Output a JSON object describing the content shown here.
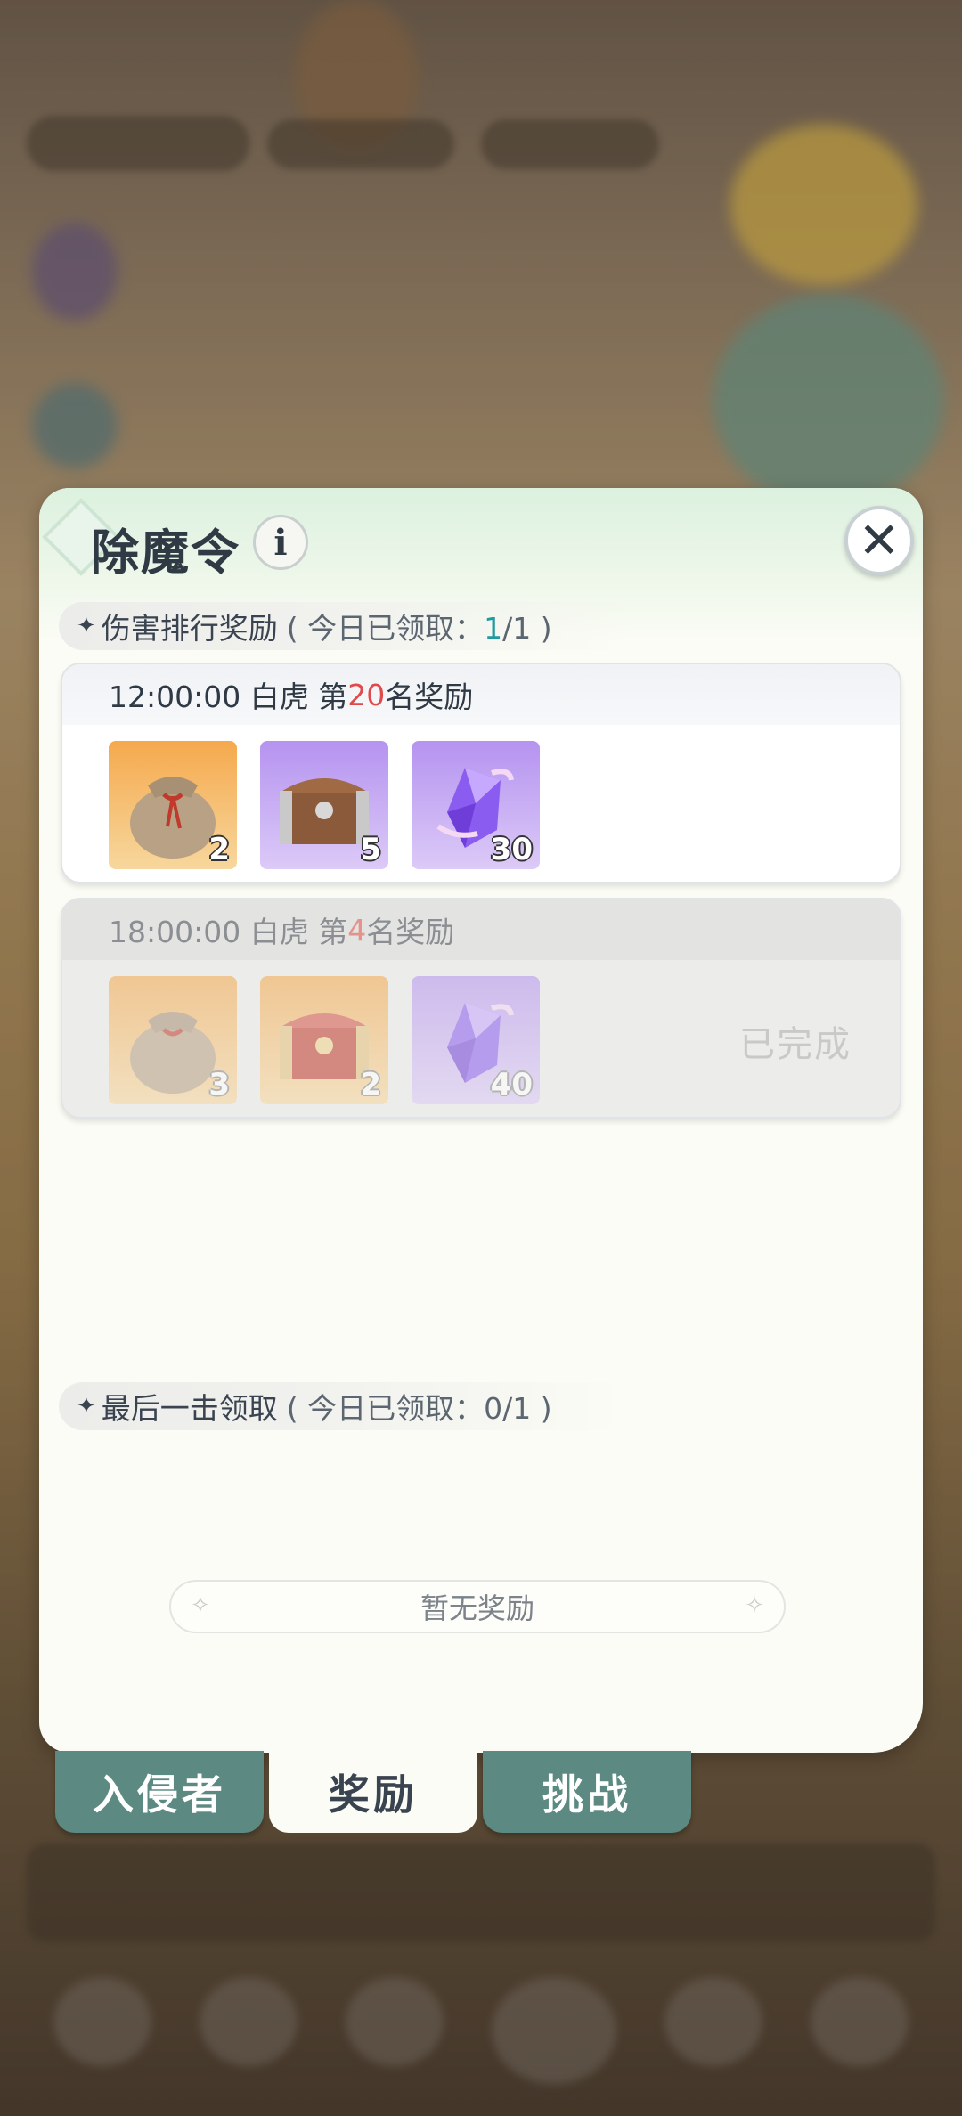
{
  "panel": {
    "title": "除魔令",
    "info_icon": "info-icon",
    "close_icon": "close-icon"
  },
  "damage_section": {
    "label": "伤害排行奖励",
    "paren_open": "( 今日已领取：",
    "claimed": "1",
    "total": "/1",
    "paren_close": " )"
  },
  "rewards": [
    {
      "time": "12:00:00 白虎 第",
      "rank": "20",
      "suffix": "名奖励",
      "items": [
        {
          "icon": "pouch-icon",
          "qty": "2",
          "bg": "orange"
        },
        {
          "icon": "chest-icon",
          "qty": "5",
          "bg": "purple"
        },
        {
          "icon": "crystal-icon",
          "qty": "30",
          "bg": "purple"
        }
      ],
      "status": ""
    },
    {
      "time": "18:00:00 白虎 第",
      "rank": "4",
      "suffix": "名奖励",
      "items": [
        {
          "icon": "pouch-icon",
          "qty": "3",
          "bg": "orange"
        },
        {
          "icon": "chest-icon",
          "qty": "2",
          "bg": "orange"
        },
        {
          "icon": "crystal-icon",
          "qty": "40",
          "bg": "purple"
        }
      ],
      "status": "已完成"
    }
  ],
  "lasthit_section": {
    "label": "最后一击领取",
    "paren": "( 今日已领取：0/1 )"
  },
  "empty_text": "暂无奖励",
  "tabs": [
    {
      "label": "入侵者",
      "active": false
    },
    {
      "label": "奖励",
      "active": true
    },
    {
      "label": "挑战",
      "active": false
    }
  ],
  "colors": {
    "accent_teal": "#1f9aa0",
    "rank_red": "#e14a4a",
    "tab_green": "#5c8a82"
  }
}
